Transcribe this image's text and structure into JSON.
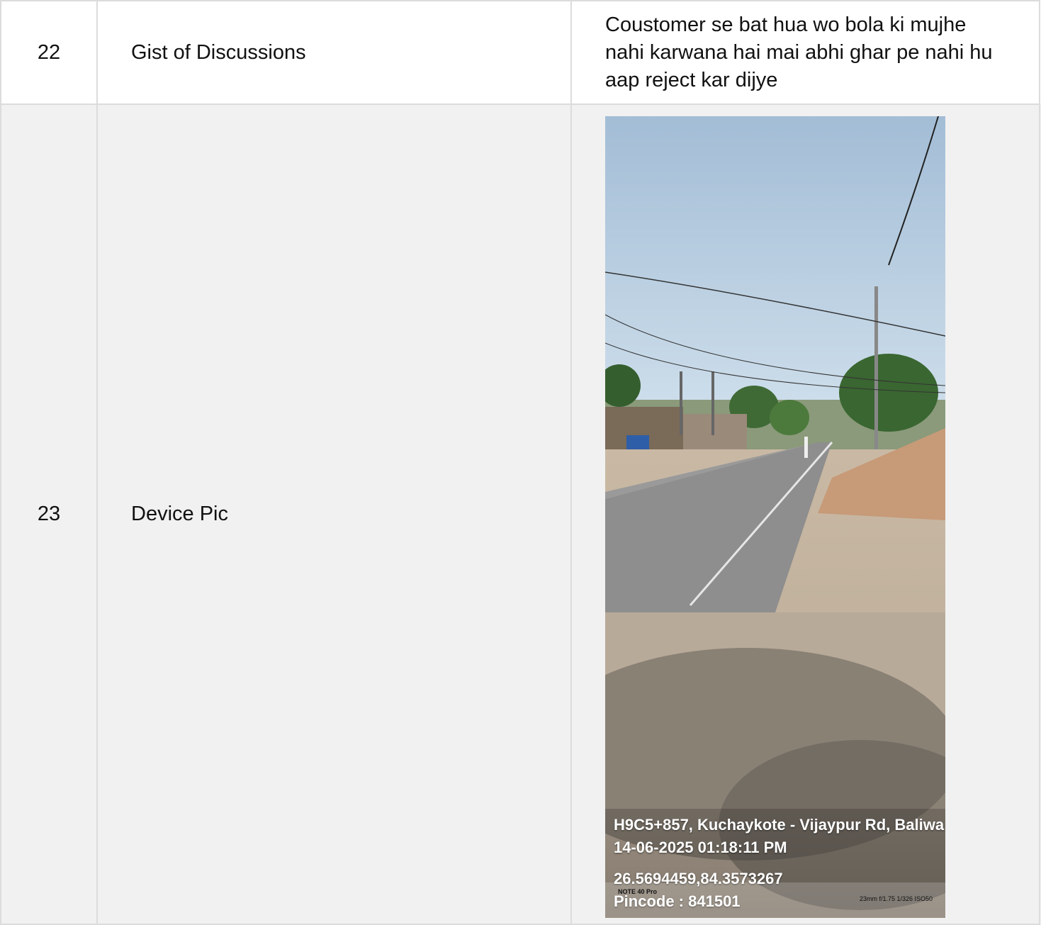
{
  "rows": [
    {
      "num": "22",
      "label": "Gist of Discussions",
      "value": "Coustomer se bat hua wo bola ki mujhe nahi karwana hai mai abhi ghar pe nahi hu aap reject kar dijye"
    },
    {
      "num": "23",
      "label": "Device Pic",
      "photo": {
        "address": "H9C5+857, Kuchaykote - Vijaypur Rd, Baliwa",
        "datetime": "14-06-2025 01:18:11 PM",
        "coordinates": "26.5694459,84.3573267",
        "pincode": "Pincode : 841501",
        "camera_model": "NOTE 40 Pro",
        "camera_specs": "23mm f/1.75 1/326 ISO50"
      }
    }
  ]
}
